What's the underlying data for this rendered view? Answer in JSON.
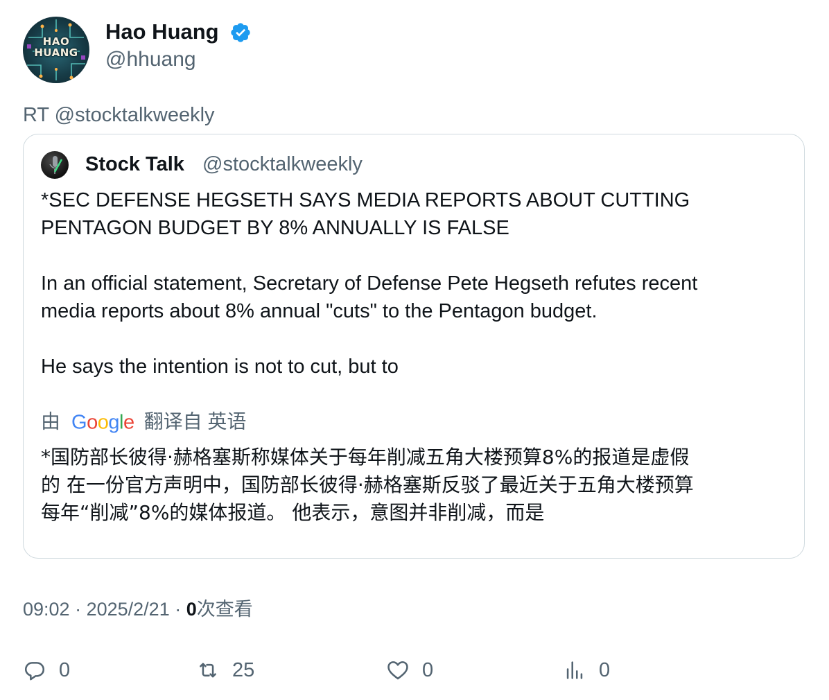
{
  "author": {
    "name": "Hao Huang",
    "handle": "@hhuang",
    "avatar_text_line1": "HAO",
    "avatar_text_line2": "HUANG",
    "verified": true
  },
  "retweet_label": "RT @stocktalkweekly",
  "quoted": {
    "name": "Stock Talk",
    "handle": "@stocktalkweekly",
    "paragraphs": [
      [
        "*SEC DEFENSE HEGSETH SAYS MEDIA REPORTS ABOUT CUTTING",
        "PENTAGON BUDGET BY 8% ANNUALLY IS FALSE"
      ],
      [
        "In an official statement, Secretary of Defense Pete Hegseth refutes recent",
        "media reports about 8% annual \"cuts\" to the Pentagon budget."
      ],
      [
        "He says the intention is not to cut, but to"
      ]
    ],
    "translation_prefix": "由",
    "translation_suffix": "翻译自 英语",
    "translated_lines": [
      "*国防部长彼得·赫格塞斯称媒体关于每年削减五角大楼预算8%的报道是虚假",
      "的 在一份官方声明中，国防部长彼得·赫格塞斯反驳了最近关于五角大楼预算",
      "每年“削减”8%的媒体报道。 他表示，意图并非削减，而是"
    ]
  },
  "meta": {
    "time": "09:02",
    "date": "2025/2/21",
    "views_count": "0",
    "views_label": "次查看"
  },
  "actions": {
    "replies": "0",
    "retweets": "25",
    "likes": "0",
    "views": "0"
  },
  "colors": {
    "text": "#0f1419",
    "secondary": "#536471",
    "border": "#cfd9de",
    "verified": "#1d9bf0",
    "google_blue": "#4285F4",
    "google_red": "#EA4335",
    "google_yellow": "#FBBC05",
    "google_green": "#34A853"
  }
}
